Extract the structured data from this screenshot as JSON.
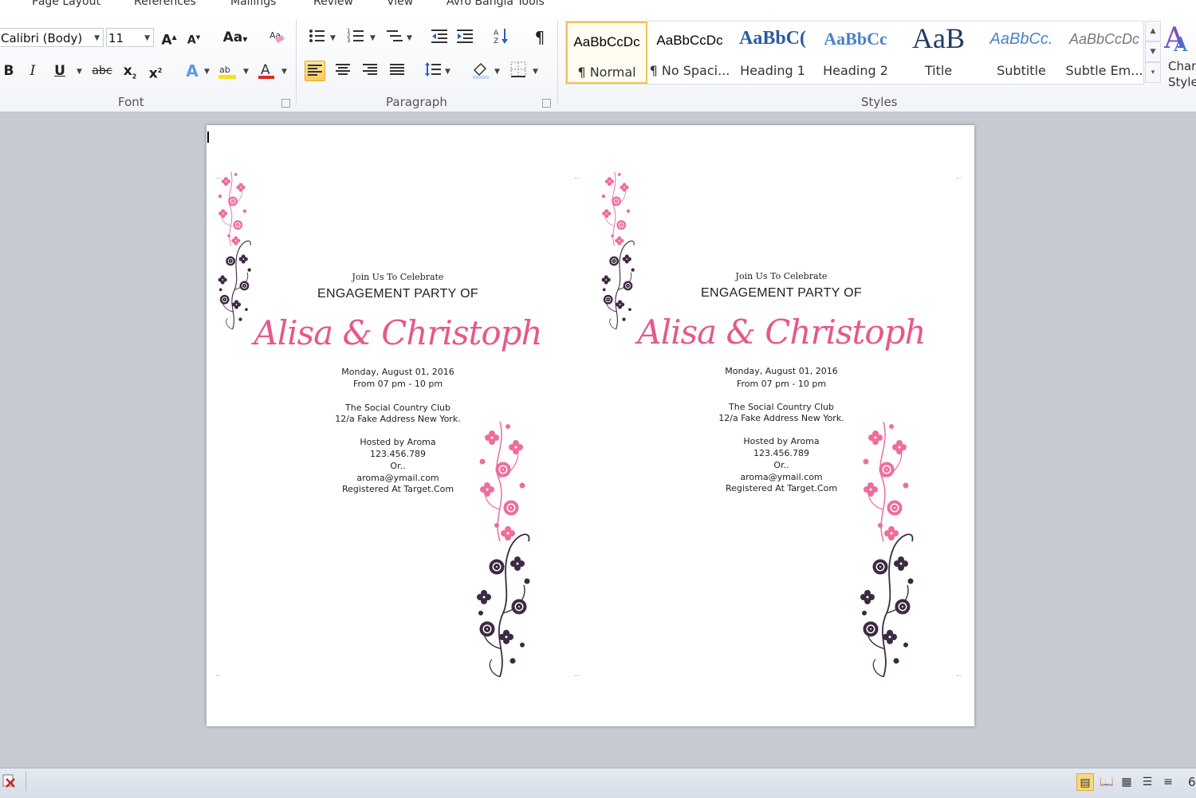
{
  "tabs": [
    "Page Layout",
    "References",
    "Mailings",
    "Review",
    "View",
    "Avro Bangla Tools"
  ],
  "font": {
    "name": "Calibri (Body)",
    "size": "11",
    "group_label": "Font"
  },
  "paragraph": {
    "group_label": "Paragraph"
  },
  "styles": {
    "group_label": "Styles",
    "items": [
      {
        "preview": "AaBbCcDc",
        "name": "¶ Normal"
      },
      {
        "preview": "AaBbCcDc",
        "name": "¶ No Spaci..."
      },
      {
        "preview": "AaBbC(",
        "name": "Heading 1"
      },
      {
        "preview": "AaBbCc",
        "name": "Heading 2"
      },
      {
        "preview": "AaB",
        "name": "Title"
      },
      {
        "preview": "AaBbCc.",
        "name": "Subtitle"
      },
      {
        "preview": "AaBbCcDc",
        "name": "Subtle Em..."
      }
    ],
    "change_label_1": "Chan",
    "change_label_2": "Style"
  },
  "invitation": {
    "intro": "Join Us To Celebrate",
    "heading": "ENGAGEMENT PARTY OF",
    "names": "Alisa & Christoph",
    "date": "Monday, August 01, 2016",
    "time": "From 07 pm - 10 pm",
    "venue": "The Social Country Club",
    "address": "12/a Fake Address New York.",
    "host": "Hosted by Aroma",
    "phone": "123.456.789",
    "or": "Or..",
    "email": "aroma@ymail.com",
    "registry": "Registered At Target.Com"
  },
  "status": {
    "zoom_partial": "6"
  },
  "colors": {
    "pink": "#ec6e9c",
    "plum": "#3d2a42",
    "accent_names": "#e6588a",
    "ribbon_highlight": "#fcca5b"
  }
}
